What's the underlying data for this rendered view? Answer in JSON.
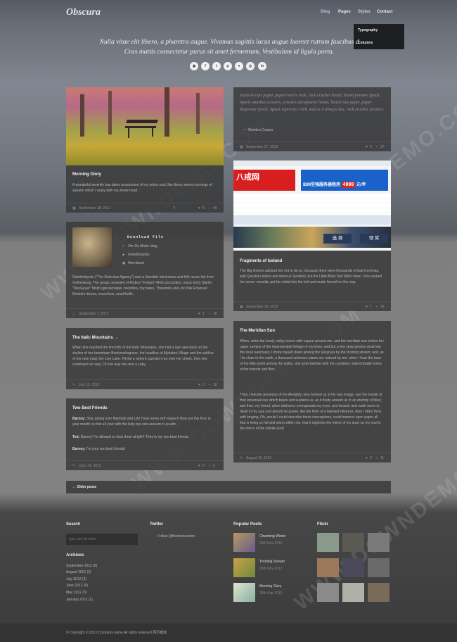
{
  "header": {
    "logo": "Obscura",
    "nav": [
      "Blog",
      "Pages",
      "Styles",
      "Contact"
    ],
    "dropdown": [
      "Typography",
      "Columns"
    ]
  },
  "hero": {
    "line1": "Nulla vitae elit libero, a pharetra augue. Vivamus sagittis lacus augue laoreet rutrum faucibus d",
    "line2": "Cras mattis consectetur purus sit amet fermentum, Vestibulum id ligula porta.",
    "social": [
      "rss-icon",
      "facebook-icon",
      "twitter-icon",
      "pinterest-icon",
      "dribbble-icon",
      "flickr-icon",
      "linkedin-icon"
    ],
    "social_glyphs": [
      "◉",
      "f",
      "t",
      "p",
      "●",
      "◎",
      "in"
    ]
  },
  "posts": {
    "morning": {
      "title": "Morning Glory",
      "body": "A wonderful serenity has taken possession of my entire soul, like these sweet mornings of autumn which I enjoy with my whole heart.",
      "date": "September 28, 2012",
      "likes": "8",
      "comments": "49"
    },
    "quote": {
      "text": "Scissors cuts paper, paper covers rock, rock crushes lizard, lizard poisons Spock, Spock smashes scissors, scissors decapitates lizard, lizard eats paper, paper disproves Spock, Spock vaporizes rock, and as it always has, rock crushes scissors.",
      "author": "— Sheldon Cooper",
      "date": "September 27, 2012",
      "likes": "6",
      "comments": "27"
    },
    "audio": {
      "label": "Download File",
      "track": "Om Du Moter Varg",
      "artist": "Detektivbyrån",
      "album": "Wermland",
      "body": "Detektivbyrån (\"The Detective Agency\") was a Swedish electronica and folk music trio from Gothenburg. The group consisted of Anders \"Fortant\" Moln (accordion, music box), Martin \"MacGyver\" Molin (glockenspiel, melodica, toy piano, Theremin) and Jon Nils Emanuel Ekström drums, sound box, small bells.",
      "date": "September 7, 2012",
      "likes": "1",
      "comments": "16"
    },
    "iceland": {
      "title": "Fragments of Iceland",
      "body": "The Big Oxmox advised her not to do so, because there were thousands of bad Commas, wild Question Marks and devious Semikoli, but the Little Blind Text didn't listen. She packed her seven versalia, put her initial into the belt and made herself on the way.",
      "date": "September 19, 2012",
      "likes": "1",
      "comments": "18"
    },
    "italic": {
      "title": "The Italic Mountains →",
      "body": "When she reached the first hills of the Italic Mountains, she had a last view back on the skyline of her hometown Bookmarksgrove, the headline of Alphabet Village and the subline of her own road, the Line Lane. Pityful a rethoric question ran over her cheek, then she continued her way. On her way she met a copy.",
      "date": "July 13, 2012",
      "likes": "0",
      "comments": "18"
    },
    "meridian": {
      "title": "The Meridian Sun",
      "p1": "When, while the lovely valley teems with vapour around me, and the meridian sun strikes the upper surface of the impenetrable foliage of my trees, and but a few stray gleams steal into the inner sanctuary, I throw myself down among the tall grass by the trickling stream; and, as I lie close to the earth, a thousand unknown plants are noticed by me: when I hear the buzz of the little world among the stalks, and grow familiar with the countless indescribable forms of the insects and flies,",
      "p2": "Then I feel the presence of the Almighty, who formed us in his own image, and the breath of that universal love which bears and sustains us, as it floats around us in an eternity of bliss; and then, my friend, when darkness overspreads my eyes, and heaven and earth seem to dwell in my soul and absorb its power, like the form of a beloved mistress, then I often think with longing, Oh, would I could describe these conceptions, could impress upon paper all that is living so full and warm within me, that it might be the mirror of my soul, as my soul is the mirror of the infinite God!",
      "date": "August 11, 2012",
      "likes": "0",
      "comments": "11"
    },
    "friends": {
      "title": "Two Best Friends",
      "lines": [
        {
          "who": "Barney:",
          "text": "Stop pining over Marshall and Lily! Have some self respect! Now put this fixer in your mouth so that all your with the lady eye cab vacuum it up with→"
        },
        {
          "who": "Ted:",
          "text": "Barney! I'm allowed to miss them alright? They're my two best friends."
        },
        {
          "who": "Barney:",
          "text": "I'm your two best friends!"
        }
      ],
      "date": "June 14, 2012",
      "likes": "0",
      "comments": "0"
    }
  },
  "older": "← Older posts",
  "footer": {
    "search": {
      "title": "Search",
      "placeholder": "type and hit enter"
    },
    "archives": {
      "title": "Archives",
      "items": [
        "September 2012 (6)",
        "August 2012 (2)",
        "July 2012 (2)",
        "June 2012 (4)",
        "May 2012 (3)",
        "January 2012 (1)"
      ]
    },
    "twitter": {
      "title": "Twitter",
      "link": "Follow @themeinvasion"
    },
    "popular": {
      "title": "Popular Posts",
      "items": [
        {
          "title": "Charming Winter",
          "date": "29th Nov 2012"
        },
        {
          "title": "Trickling Stream",
          "date": "26th Nov 2012"
        },
        {
          "title": "Morning Glory",
          "date": "28th Sep 2012"
        }
      ]
    },
    "flickr": {
      "title": "Flickr"
    },
    "copyright": "© Copyright © 2013 Company name All rights reserved 网页模板"
  },
  "ad": {
    "site1": "八戒网",
    "site2": "IBM至强服务器租用",
    "price": "4999",
    "unit": "元/年",
    "btn1": "选  择",
    "btn2": "领  奖"
  },
  "watermark": "WWW.DOWNDEMO.COM"
}
